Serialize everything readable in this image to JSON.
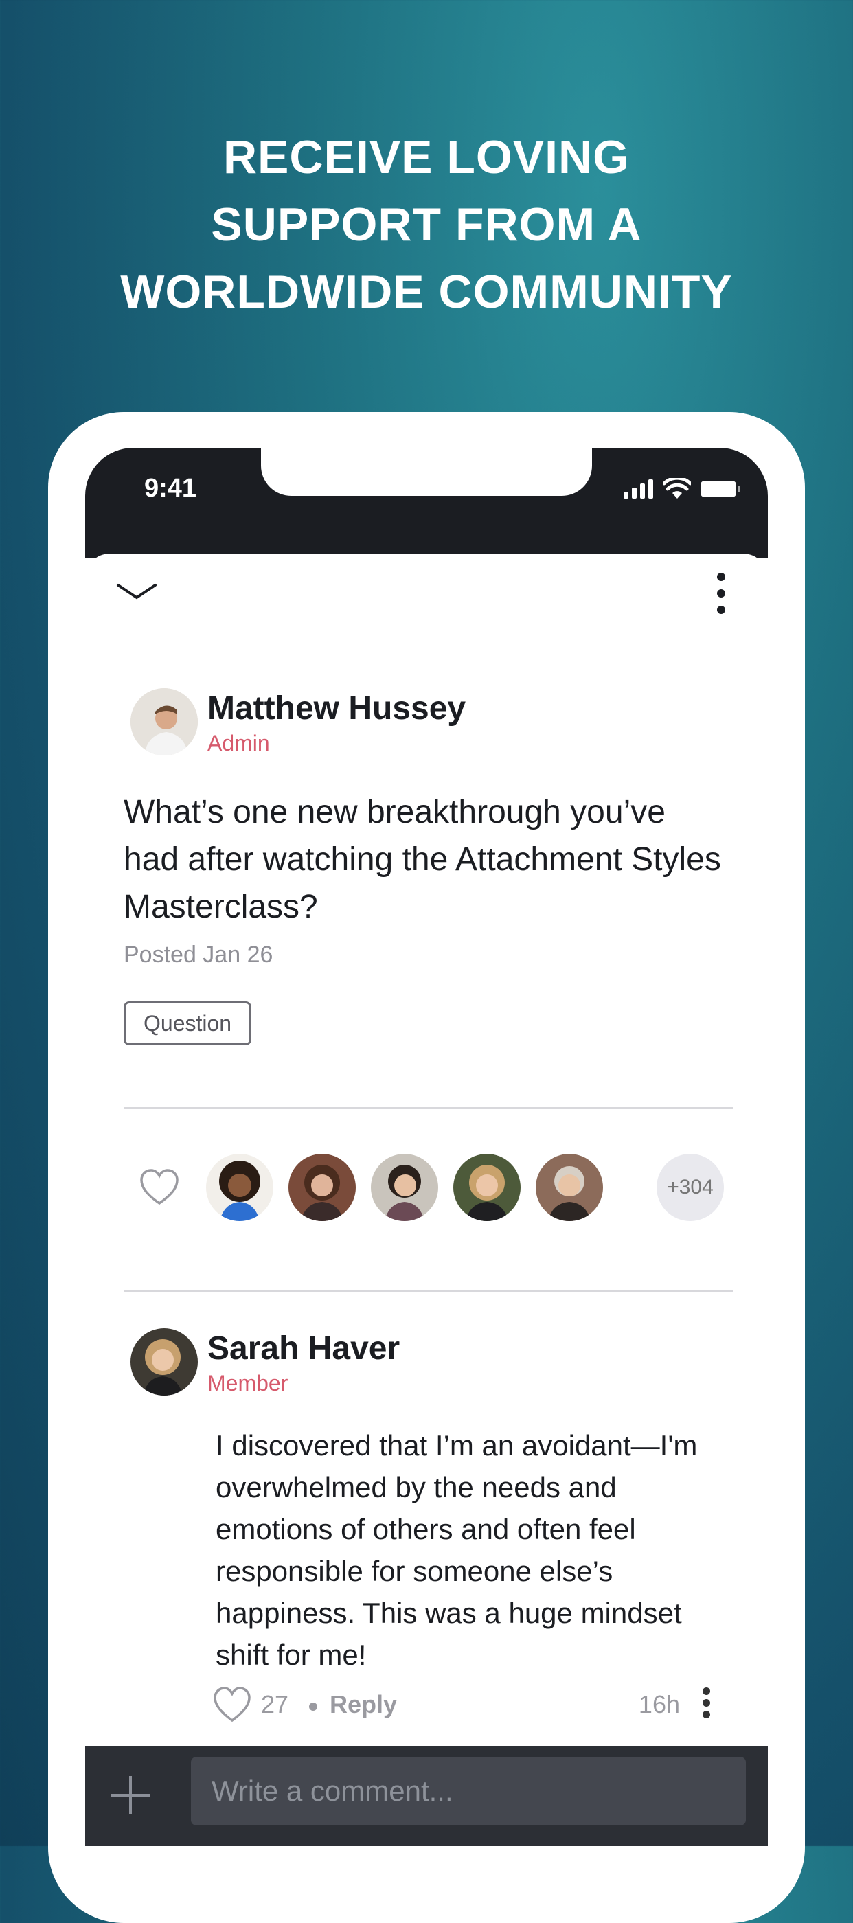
{
  "headline": {
    "line1": "RECEIVE LOVING",
    "line2": "SUPPORT FROM A",
    "line3": "WORLDWIDE COMMUNITY"
  },
  "status_bar": {
    "time": "9:41"
  },
  "post": {
    "author": {
      "name": "Matthew Hussey",
      "role": "Admin"
    },
    "text": "What’s one new breakthrough you’ve had after watching the Attachment Styles Masterclass?",
    "posted": "Posted Jan 26",
    "tag": "Question",
    "likers_more": "+304"
  },
  "comment": {
    "author": {
      "name": "Sarah Haver",
      "role": "Member"
    },
    "text": "I discovered that I’m an avoidant—I'm overwhelmed by the needs and emotions of others and often feel responsible for someone else’s happiness. This was a huge mindset shift for me!",
    "likes": "27",
    "reply_label": "Reply",
    "age": "16h"
  },
  "composer": {
    "placeholder": "Write a comment..."
  },
  "colors": {
    "accent_role": "#d65a6c",
    "dark": "#1b1d22",
    "background_teal": "#1e6f80"
  }
}
